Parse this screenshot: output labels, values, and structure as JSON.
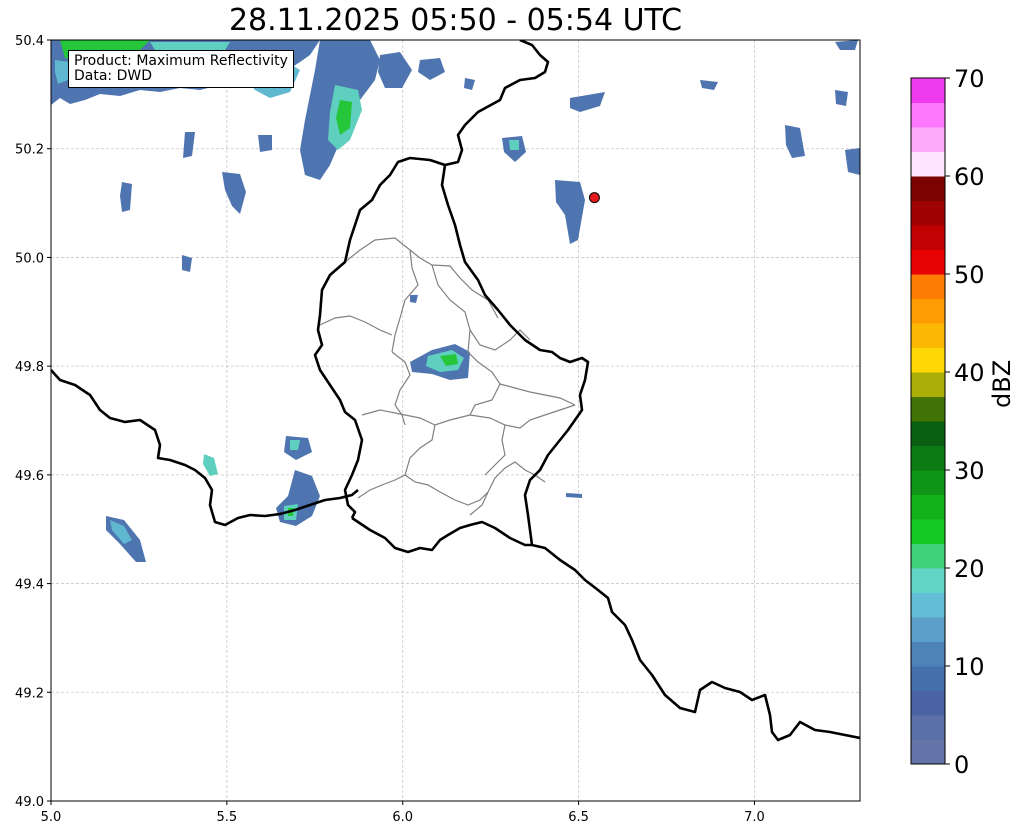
{
  "title": "28.11.2025 05:50 - 05:54 UTC",
  "info": {
    "product": "Product: Maximum Reflectivity",
    "source": "Data: DWD"
  },
  "axes": {
    "x_ticks": [
      "5.0",
      "5.5",
      "6.0",
      "6.5",
      "7.0"
    ],
    "y_ticks": [
      "50.4",
      "50.2",
      "50.0",
      "49.8",
      "49.6",
      "49.4",
      "49.2",
      "49.0"
    ],
    "xlim": [
      5.0,
      7.3
    ],
    "ylim": [
      49.0,
      50.4
    ],
    "grid": true
  },
  "colorbar": {
    "label": "dBZ",
    "ticks": [
      "0",
      "10",
      "20",
      "30",
      "40",
      "50",
      "60",
      "70"
    ],
    "range": [
      0,
      70
    ],
    "colors": [
      "#6474a8",
      "#5b6fa8",
      "#4a63a2",
      "#4670ab",
      "#4e83b8",
      "#5b9fca",
      "#62bdd6",
      "#62d4c6",
      "#3fd27a",
      "#14c921",
      "#12b21a",
      "#0e9516",
      "#0c7b14",
      "#0a5f10",
      "#417307",
      "#aaae06",
      "#fdd704",
      "#fdb804",
      "#fd9c04",
      "#fd7c04",
      "#e70303",
      "#c20202",
      "#9e0202",
      "#7c0202",
      "#fde3fd",
      "#fdaafd",
      "#fd78fd",
      "#ef3af0"
    ]
  },
  "marker": {
    "lon": 6.545,
    "lat": 50.11,
    "color": "#e41a1c"
  },
  "colors": {
    "border": "#000000",
    "canton": "#808080",
    "grid": "#c8c8c8"
  }
}
